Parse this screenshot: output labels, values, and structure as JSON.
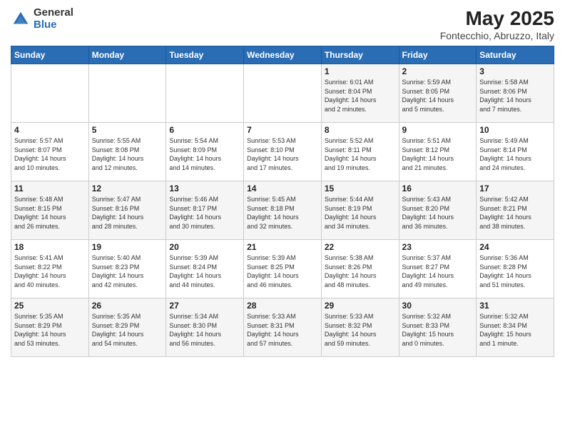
{
  "header": {
    "logo_general": "General",
    "logo_blue": "Blue",
    "title": "May 2025",
    "subtitle": "Fontecchio, Abruzzo, Italy"
  },
  "calendar": {
    "days_of_week": [
      "Sunday",
      "Monday",
      "Tuesday",
      "Wednesday",
      "Thursday",
      "Friday",
      "Saturday"
    ],
    "weeks": [
      [
        {
          "day": "",
          "info": ""
        },
        {
          "day": "",
          "info": ""
        },
        {
          "day": "",
          "info": ""
        },
        {
          "day": "",
          "info": ""
        },
        {
          "day": "1",
          "info": "Sunrise: 6:01 AM\nSunset: 8:04 PM\nDaylight: 14 hours\nand 2 minutes."
        },
        {
          "day": "2",
          "info": "Sunrise: 5:59 AM\nSunset: 8:05 PM\nDaylight: 14 hours\nand 5 minutes."
        },
        {
          "day": "3",
          "info": "Sunrise: 5:58 AM\nSunset: 8:06 PM\nDaylight: 14 hours\nand 7 minutes."
        }
      ],
      [
        {
          "day": "4",
          "info": "Sunrise: 5:57 AM\nSunset: 8:07 PM\nDaylight: 14 hours\nand 10 minutes."
        },
        {
          "day": "5",
          "info": "Sunrise: 5:55 AM\nSunset: 8:08 PM\nDaylight: 14 hours\nand 12 minutes."
        },
        {
          "day": "6",
          "info": "Sunrise: 5:54 AM\nSunset: 8:09 PM\nDaylight: 14 hours\nand 14 minutes."
        },
        {
          "day": "7",
          "info": "Sunrise: 5:53 AM\nSunset: 8:10 PM\nDaylight: 14 hours\nand 17 minutes."
        },
        {
          "day": "8",
          "info": "Sunrise: 5:52 AM\nSunset: 8:11 PM\nDaylight: 14 hours\nand 19 minutes."
        },
        {
          "day": "9",
          "info": "Sunrise: 5:51 AM\nSunset: 8:12 PM\nDaylight: 14 hours\nand 21 minutes."
        },
        {
          "day": "10",
          "info": "Sunrise: 5:49 AM\nSunset: 8:14 PM\nDaylight: 14 hours\nand 24 minutes."
        }
      ],
      [
        {
          "day": "11",
          "info": "Sunrise: 5:48 AM\nSunset: 8:15 PM\nDaylight: 14 hours\nand 26 minutes."
        },
        {
          "day": "12",
          "info": "Sunrise: 5:47 AM\nSunset: 8:16 PM\nDaylight: 14 hours\nand 28 minutes."
        },
        {
          "day": "13",
          "info": "Sunrise: 5:46 AM\nSunset: 8:17 PM\nDaylight: 14 hours\nand 30 minutes."
        },
        {
          "day": "14",
          "info": "Sunrise: 5:45 AM\nSunset: 8:18 PM\nDaylight: 14 hours\nand 32 minutes."
        },
        {
          "day": "15",
          "info": "Sunrise: 5:44 AM\nSunset: 8:19 PM\nDaylight: 14 hours\nand 34 minutes."
        },
        {
          "day": "16",
          "info": "Sunrise: 5:43 AM\nSunset: 8:20 PM\nDaylight: 14 hours\nand 36 minutes."
        },
        {
          "day": "17",
          "info": "Sunrise: 5:42 AM\nSunset: 8:21 PM\nDaylight: 14 hours\nand 38 minutes."
        }
      ],
      [
        {
          "day": "18",
          "info": "Sunrise: 5:41 AM\nSunset: 8:22 PM\nDaylight: 14 hours\nand 40 minutes."
        },
        {
          "day": "19",
          "info": "Sunrise: 5:40 AM\nSunset: 8:23 PM\nDaylight: 14 hours\nand 42 minutes."
        },
        {
          "day": "20",
          "info": "Sunrise: 5:39 AM\nSunset: 8:24 PM\nDaylight: 14 hours\nand 44 minutes."
        },
        {
          "day": "21",
          "info": "Sunrise: 5:39 AM\nSunset: 8:25 PM\nDaylight: 14 hours\nand 46 minutes."
        },
        {
          "day": "22",
          "info": "Sunrise: 5:38 AM\nSunset: 8:26 PM\nDaylight: 14 hours\nand 48 minutes."
        },
        {
          "day": "23",
          "info": "Sunrise: 5:37 AM\nSunset: 8:27 PM\nDaylight: 14 hours\nand 49 minutes."
        },
        {
          "day": "24",
          "info": "Sunrise: 5:36 AM\nSunset: 8:28 PM\nDaylight: 14 hours\nand 51 minutes."
        }
      ],
      [
        {
          "day": "25",
          "info": "Sunrise: 5:35 AM\nSunset: 8:29 PM\nDaylight: 14 hours\nand 53 minutes."
        },
        {
          "day": "26",
          "info": "Sunrise: 5:35 AM\nSunset: 8:29 PM\nDaylight: 14 hours\nand 54 minutes."
        },
        {
          "day": "27",
          "info": "Sunrise: 5:34 AM\nSunset: 8:30 PM\nDaylight: 14 hours\nand 56 minutes."
        },
        {
          "day": "28",
          "info": "Sunrise: 5:33 AM\nSunset: 8:31 PM\nDaylight: 14 hours\nand 57 minutes."
        },
        {
          "day": "29",
          "info": "Sunrise: 5:33 AM\nSunset: 8:32 PM\nDaylight: 14 hours\nand 59 minutes."
        },
        {
          "day": "30",
          "info": "Sunrise: 5:32 AM\nSunset: 8:33 PM\nDaylight: 15 hours\nand 0 minutes."
        },
        {
          "day": "31",
          "info": "Sunrise: 5:32 AM\nSunset: 8:34 PM\nDaylight: 15 hours\nand 1 minute."
        }
      ]
    ]
  }
}
